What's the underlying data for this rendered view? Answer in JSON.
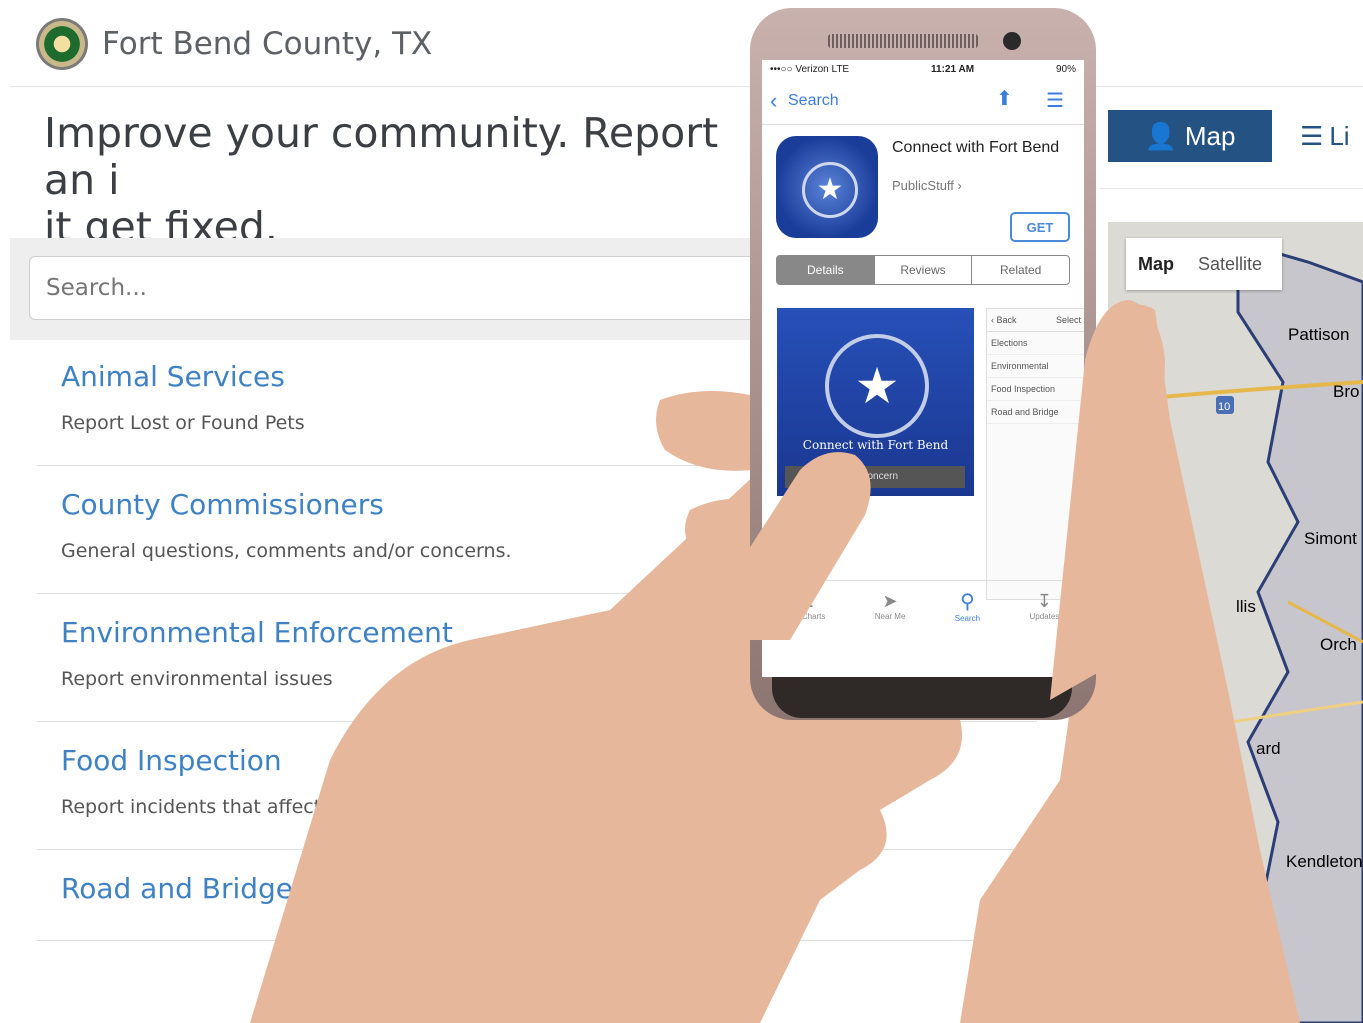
{
  "header": {
    "brand": "Fort Bend County, TX"
  },
  "headline": "Improve your community. Report an i\nit get fixed.",
  "search": {
    "placeholder": "Search..."
  },
  "categories": [
    {
      "title": "Animal Services",
      "desc": "Report Lost or Found Pets"
    },
    {
      "title": "County Commissioners",
      "desc": "General questions, comments and/or concerns."
    },
    {
      "title": "Environmental Enforcement",
      "desc": "Report environmental issues"
    },
    {
      "title": "Food Inspection",
      "desc": "Report incidents that affect"
    },
    {
      "title": "Road and Bridge",
      "desc": ""
    }
  ],
  "view_toggle": {
    "map_label": "Map",
    "list_label": "Li"
  },
  "map": {
    "toggle": {
      "map": "Map",
      "satellite": "Satellite"
    },
    "places": [
      "Pattison",
      "Bro",
      "Simont",
      "Orch",
      "ard",
      "Kendleton",
      "llis"
    ],
    "highway": "10"
  },
  "phone": {
    "status": {
      "carrier": "•••○○ Verizon  LTE",
      "time": "11:21 AM",
      "battery": "90%"
    },
    "nav": {
      "back": "Search"
    },
    "app": {
      "title": "Connect with Fort Bend",
      "developer": "PublicStuff ›",
      "get": "GET"
    },
    "segments": [
      "Details",
      "Reviews",
      "Related"
    ],
    "screenshot": {
      "caption": "Connect with Fort Bend",
      "action": "e Concern"
    },
    "list_preview": {
      "back": "‹ Back",
      "select": "Select",
      "items": [
        "Elections",
        "Environmental",
        "Food Inspection",
        "Road and Bridge"
      ]
    },
    "tabbar": [
      "Top Charts",
      "Near Me",
      "Search",
      "Updates"
    ]
  },
  "colors": {
    "accent": "#235283",
    "link": "#3f82c4"
  }
}
